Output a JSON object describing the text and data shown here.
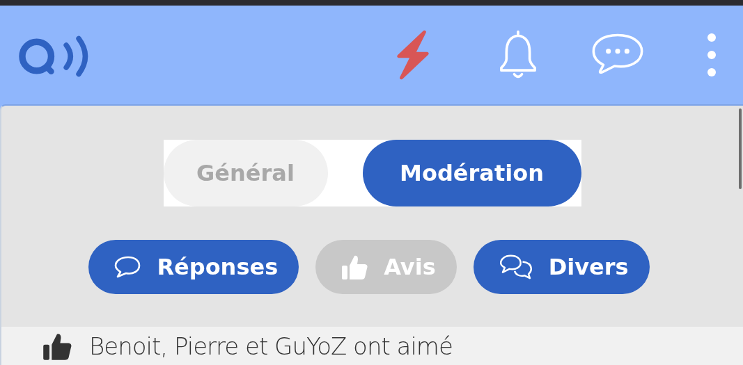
{
  "tabs": [
    {
      "label": "Général",
      "selected": false
    },
    {
      "label": "Modération",
      "selected": true
    }
  ],
  "filters": [
    {
      "label": "Réponses",
      "kind": "reply",
      "selected": true
    },
    {
      "label": "Avis",
      "kind": "like",
      "selected": false
    },
    {
      "label": "Divers",
      "kind": "chat",
      "selected": true
    }
  ],
  "feed": [
    {
      "text": "Benoit, Pierre et GuYoZ ont aimé"
    }
  ]
}
